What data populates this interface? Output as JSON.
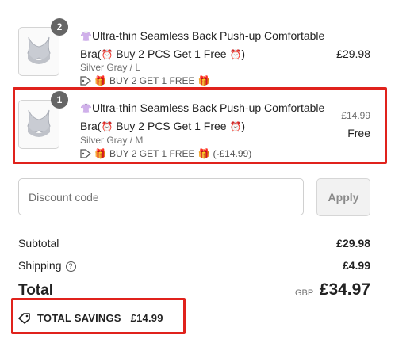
{
  "items": [
    {
      "quantity": "2",
      "title_prefix": "👚",
      "title_main": "Ultra-thin Seamless Back Push-up Comfortable",
      "title_line2_start": "Bra(",
      "title_clock": "⏰",
      "title_line2_mid": " Buy 2 PCS Get 1 Free ",
      "title_line2_end": ")",
      "variant": "Silver Gray / L",
      "promo_gift": "🎁",
      "promo_text": "BUY 2 GET 1 FREE",
      "promo_suffix": "",
      "price": "£29.98",
      "original_price": ""
    },
    {
      "quantity": "1",
      "title_prefix": "👚",
      "title_main": "Ultra-thin Seamless Back Push-up Comfortable",
      "title_line2_start": "Bra(",
      "title_clock": "⏰",
      "title_line2_mid": " Buy 2 PCS Get 1 Free ",
      "title_line2_end": ")",
      "variant": "Silver Gray / M",
      "promo_gift": "🎁",
      "promo_text": "BUY 2 GET 1 FREE",
      "promo_suffix": "(-£14.99)",
      "price": "Free",
      "original_price": "£14.99"
    }
  ],
  "discount": {
    "placeholder": "Discount code",
    "apply_label": "Apply"
  },
  "summary": {
    "subtotal_label": "Subtotal",
    "subtotal_value": "£29.98",
    "shipping_label": "Shipping",
    "shipping_value": "£4.99",
    "total_label": "Total",
    "currency": "GBP",
    "total_value": "£34.97",
    "savings_label": "TOTAL SAVINGS",
    "savings_value": "£14.99"
  },
  "colors": {
    "highlight": "#e0221c",
    "badge": "#666666"
  },
  "icons": [
    "tag-icon",
    "help-icon",
    "gift-icon",
    "clock-icon",
    "shirt-icon"
  ]
}
